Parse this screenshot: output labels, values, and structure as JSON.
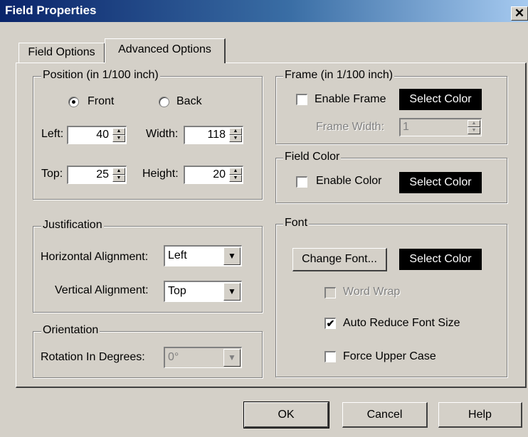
{
  "window": {
    "title": "Field Properties",
    "close_glyph": "✕"
  },
  "tabs": [
    {
      "label": "Field Options"
    },
    {
      "label": "Advanced Options"
    }
  ],
  "position": {
    "legend": "Position (in 1/100 inch)",
    "front_label": "Front",
    "back_label": "Back",
    "selected": "Front",
    "left_label": "Left:",
    "left_value": "40",
    "width_label": "Width:",
    "width_value": "118",
    "top_label": "Top:",
    "top_value": "25",
    "height_label": "Height:",
    "height_value": "20"
  },
  "justification": {
    "legend": "Justification",
    "horizontal_label": "Horizontal Alignment:",
    "horizontal_value": "Left",
    "vertical_label": "Vertical Alignment:",
    "vertical_value": "Top"
  },
  "orientation": {
    "legend": "Orientation",
    "rotation_label": "Rotation In Degrees:",
    "rotation_value": "0°"
  },
  "frame": {
    "legend": "Frame (in 1/100 inch)",
    "enable_label": "Enable Frame",
    "enable_checked": false,
    "select_color_label": "Select Color",
    "width_label": "Frame Width:",
    "width_value": "1"
  },
  "field_color": {
    "legend": "Field Color",
    "enable_label": "Enable Color",
    "enable_checked": false,
    "select_color_label": "Select Color"
  },
  "font": {
    "legend": "Font",
    "change_font_label": "Change Font...",
    "select_color_label": "Select Color",
    "word_wrap_label": "Word Wrap",
    "word_wrap_checked": false,
    "auto_reduce_label": "Auto Reduce Font Size",
    "auto_reduce_checked": true,
    "force_upper_label": "Force Upper Case",
    "force_upper_checked": false
  },
  "footer": {
    "ok_label": "OK",
    "cancel_label": "Cancel",
    "help_label": "Help"
  },
  "colors": {
    "dialog_face": "#d4d0c8",
    "titlebar_start": "#0a246a",
    "titlebar_end": "#a6caf0",
    "color_swatch": "#000000"
  },
  "icons": {
    "checkmark": "✔",
    "spin_up": "▲",
    "spin_down": "▼",
    "combo_arrow": "▼"
  }
}
